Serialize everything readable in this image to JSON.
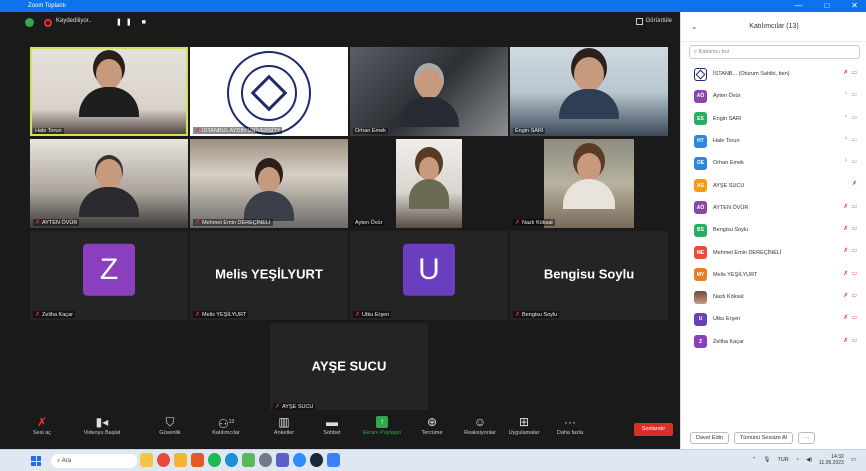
{
  "window": {
    "title": "Zoom Toplantı",
    "min_glyph": "—",
    "max_glyph": "□",
    "close_glyph": "✕"
  },
  "top_strip": {
    "recording_label": "Kaydediliyor..",
    "recording_controls": "❚❚ ■",
    "view_label": "Görüntüle"
  },
  "tiles": [
    {
      "name": "Hale Torun",
      "muted": false
    },
    {
      "name": "İSTANBUL AYDIN UNİVERSİTY",
      "muted": true,
      "logo_text": "İSTANBUL AYDIN ÜNİVERSİTESİ"
    },
    {
      "name": "Orhan Emek",
      "muted": false
    },
    {
      "name": "Engin SARI",
      "muted": false
    },
    {
      "name": "AYTEN ÖVÜR",
      "muted": true
    },
    {
      "name": "Mehmet Emin DEREÇİNELİ",
      "muted": true
    },
    {
      "name": "Ayten Övür",
      "muted": false
    },
    {
      "name": "Nazlı Köksal",
      "muted": true
    },
    {
      "name": "Zeliha Kaçar",
      "muted": true,
      "initial": "Z",
      "color": "#8a3fbf"
    },
    {
      "name": "Melis YEŞİLYURT",
      "muted": true,
      "display": "Melis YEŞİLYURT"
    },
    {
      "name": "Utku Erşen",
      "muted": true,
      "initial": "U",
      "color": "#6a3fbf"
    },
    {
      "name": "Bengisu Soylu",
      "muted": true,
      "display": "Bengisu Soylu"
    },
    {
      "name": "AYŞE SUCU",
      "muted": true,
      "display": "AYŞE SUCU"
    }
  ],
  "toolbar": {
    "items": [
      {
        "label": "Sesi aç",
        "icon": "mic-muted-icon",
        "glyph": "🎤"
      },
      {
        "label": "Videoyu Başlat",
        "icon": "video-off-icon",
        "glyph": "📹"
      },
      {
        "label": "Güvenlik",
        "icon": "shield-icon",
        "glyph": "🛡"
      },
      {
        "label": "Katılımcılar",
        "icon": "participants-icon",
        "glyph": "👥",
        "count": "13"
      },
      {
        "label": "Anketler",
        "icon": "polls-icon",
        "glyph": "▥"
      },
      {
        "label": "Sohbet",
        "icon": "chat-icon",
        "glyph": "💬"
      },
      {
        "label": "Ekranı Paylaşın",
        "icon": "share-screen-icon",
        "glyph": "↑"
      },
      {
        "label": "Tercüme",
        "icon": "globe-icon",
        "glyph": "⊕"
      },
      {
        "label": "Reaksiyonlar",
        "icon": "reactions-icon",
        "glyph": "☺"
      },
      {
        "label": "Uygulamalar",
        "icon": "apps-icon",
        "glyph": "⊞"
      },
      {
        "label": "Daha fazla",
        "icon": "more-icon",
        "glyph": "···"
      }
    ],
    "end_label": "Sonlandır"
  },
  "panel": {
    "title": "Katılımcılar (13)",
    "search_placeholder": "Katılımcı bul",
    "participants": [
      {
        "name": "İSTANB... (Oturum Sahibi, ben)",
        "initials": "",
        "color": "#ffffff",
        "mic": "red",
        "cam": "red",
        "logo": true
      },
      {
        "name": "Ayten Övür",
        "initials": "AÖ",
        "color": "#8e44ad",
        "mic": "gray",
        "cam": "gray"
      },
      {
        "name": "Engin SARI",
        "initials": "ES",
        "color": "#27ae60",
        "mic": "gray",
        "cam": "gray"
      },
      {
        "name": "Hale Torun",
        "initials": "HT",
        "color": "#2e86de",
        "mic": "gray",
        "cam": "gray"
      },
      {
        "name": "Orhan Emek",
        "initials": "OE",
        "color": "#2e86de",
        "mic": "gray",
        "cam": "gray"
      },
      {
        "name": "AYŞE SUCU",
        "initials": "AS",
        "color": "#f39c12",
        "mic": "red",
        "cam": "none"
      },
      {
        "name": "AYTEN ÖVÜR",
        "initials": "AÖ",
        "color": "#8e44ad",
        "mic": "red",
        "cam": "red"
      },
      {
        "name": "Bengisu Soylu",
        "initials": "BS",
        "color": "#27ae60",
        "mic": "red",
        "cam": "red"
      },
      {
        "name": "Mehmet Emin DEREÇİNELİ",
        "initials": "ME",
        "color": "#e74c3c",
        "mic": "red",
        "cam": "red"
      },
      {
        "name": "Melis YEŞİLYURT",
        "initials": "MY",
        "color": "#e67e22",
        "mic": "red",
        "cam": "red"
      },
      {
        "name": "Nazlı Köksal",
        "initials": "",
        "color": "#7a5040",
        "mic": "red",
        "cam": "red",
        "photo": true
      },
      {
        "name": "Utku Erşen",
        "initials": "U",
        "color": "#6a3fbf",
        "mic": "red",
        "cam": "red"
      },
      {
        "name": "Zeliha Kaçar",
        "initials": "Z",
        "color": "#8a3fbf",
        "mic": "red",
        "cam": "red"
      }
    ],
    "invite_label": "Davet Edin",
    "mute_all_label": "Tümünü Sessize Al",
    "more_label": "···"
  },
  "taskbar": {
    "search_placeholder": "Ara",
    "lang": "TUR",
    "time": "14:32",
    "date": "11.05.2023"
  }
}
